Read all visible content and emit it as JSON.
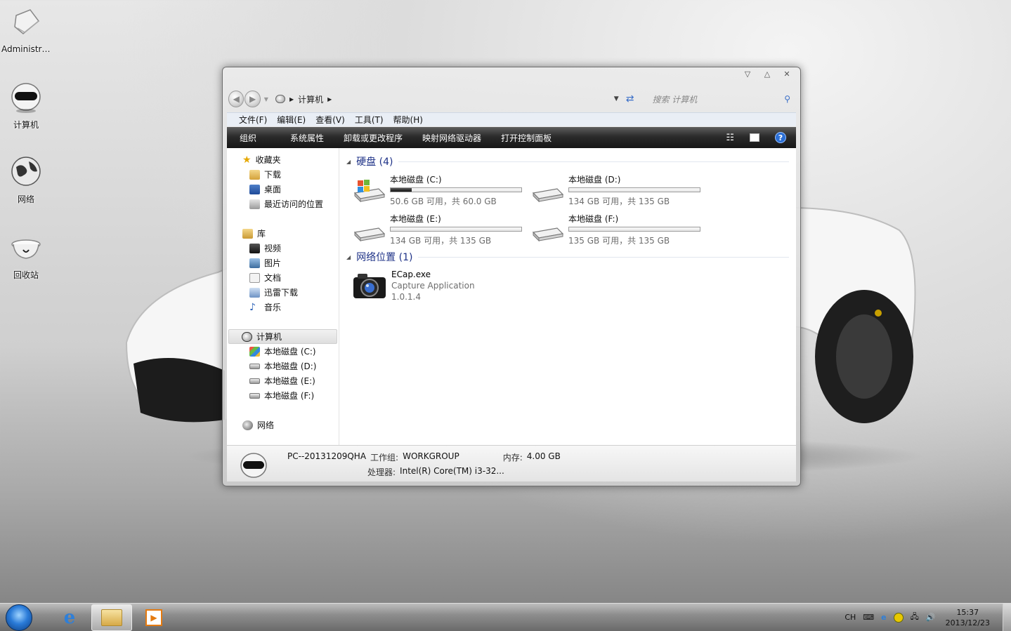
{
  "desktop": {
    "icons": [
      {
        "label": "Administra..."
      },
      {
        "label": "计算机"
      },
      {
        "label": "网络"
      },
      {
        "label": "回收站"
      }
    ]
  },
  "window": {
    "breadcrumb": {
      "location": "计算机"
    },
    "search_placeholder": "搜索 计算机",
    "menu": [
      "文件(F)",
      "编辑(E)",
      "查看(V)",
      "工具(T)",
      "帮助(H)"
    ],
    "toolbar": [
      "组织",
      "系统属性",
      "卸载或更改程序",
      "映射网络驱动器",
      "打开控制面板"
    ],
    "nav": {
      "favorites": {
        "title": "收藏夹",
        "items": [
          "下载",
          "桌面",
          "最近访问的位置"
        ]
      },
      "libraries": {
        "title": "库",
        "items": [
          "视频",
          "图片",
          "文档",
          "迅雷下载",
          "音乐"
        ]
      },
      "computer": {
        "title": "计算机",
        "items": [
          "本地磁盘 (C:)",
          "本地磁盘 (D:)",
          "本地磁盘 (E:)",
          "本地磁盘 (F:)"
        ]
      },
      "network": {
        "title": "网络"
      }
    },
    "groups": {
      "harddisks": {
        "title": "硬盘 (4)"
      },
      "network": {
        "title": "网络位置 (1)"
      }
    },
    "drives": [
      {
        "name": "本地磁盘 (C:)",
        "free_text": "50.6 GB 可用，共 60.0 GB",
        "used_fraction": 0.16
      },
      {
        "name": "本地磁盘 (D:)",
        "free_text": "134 GB 可用，共 135 GB",
        "used_fraction": 0.0
      },
      {
        "name": "本地磁盘 (E:)",
        "free_text": "134 GB 可用，共 135 GB",
        "used_fraction": 0.0
      },
      {
        "name": "本地磁盘 (F:)",
        "free_text": "135 GB 可用，共 135 GB",
        "used_fraction": 0.0
      }
    ],
    "network_item": {
      "name": "ECap.exe",
      "desc": "Capture Application",
      "version": "1.0.1.4"
    },
    "details": {
      "pc_name": "PC--20131209QHA",
      "workgroup_label": "工作组:",
      "workgroup": "WORKGROUP",
      "memory_label": "内存:",
      "memory": "4.00 GB",
      "cpu_label": "处理器:",
      "cpu": "Intel(R) Core(TM) i3-32..."
    }
  },
  "taskbar": {
    "lang": "CH",
    "time": "15:37",
    "date": "2013/12/23"
  },
  "colors": {
    "group_title": "#1e3287",
    "toolbar_bg": "#1b1b1b",
    "help_blue": "#2b6fd6"
  }
}
